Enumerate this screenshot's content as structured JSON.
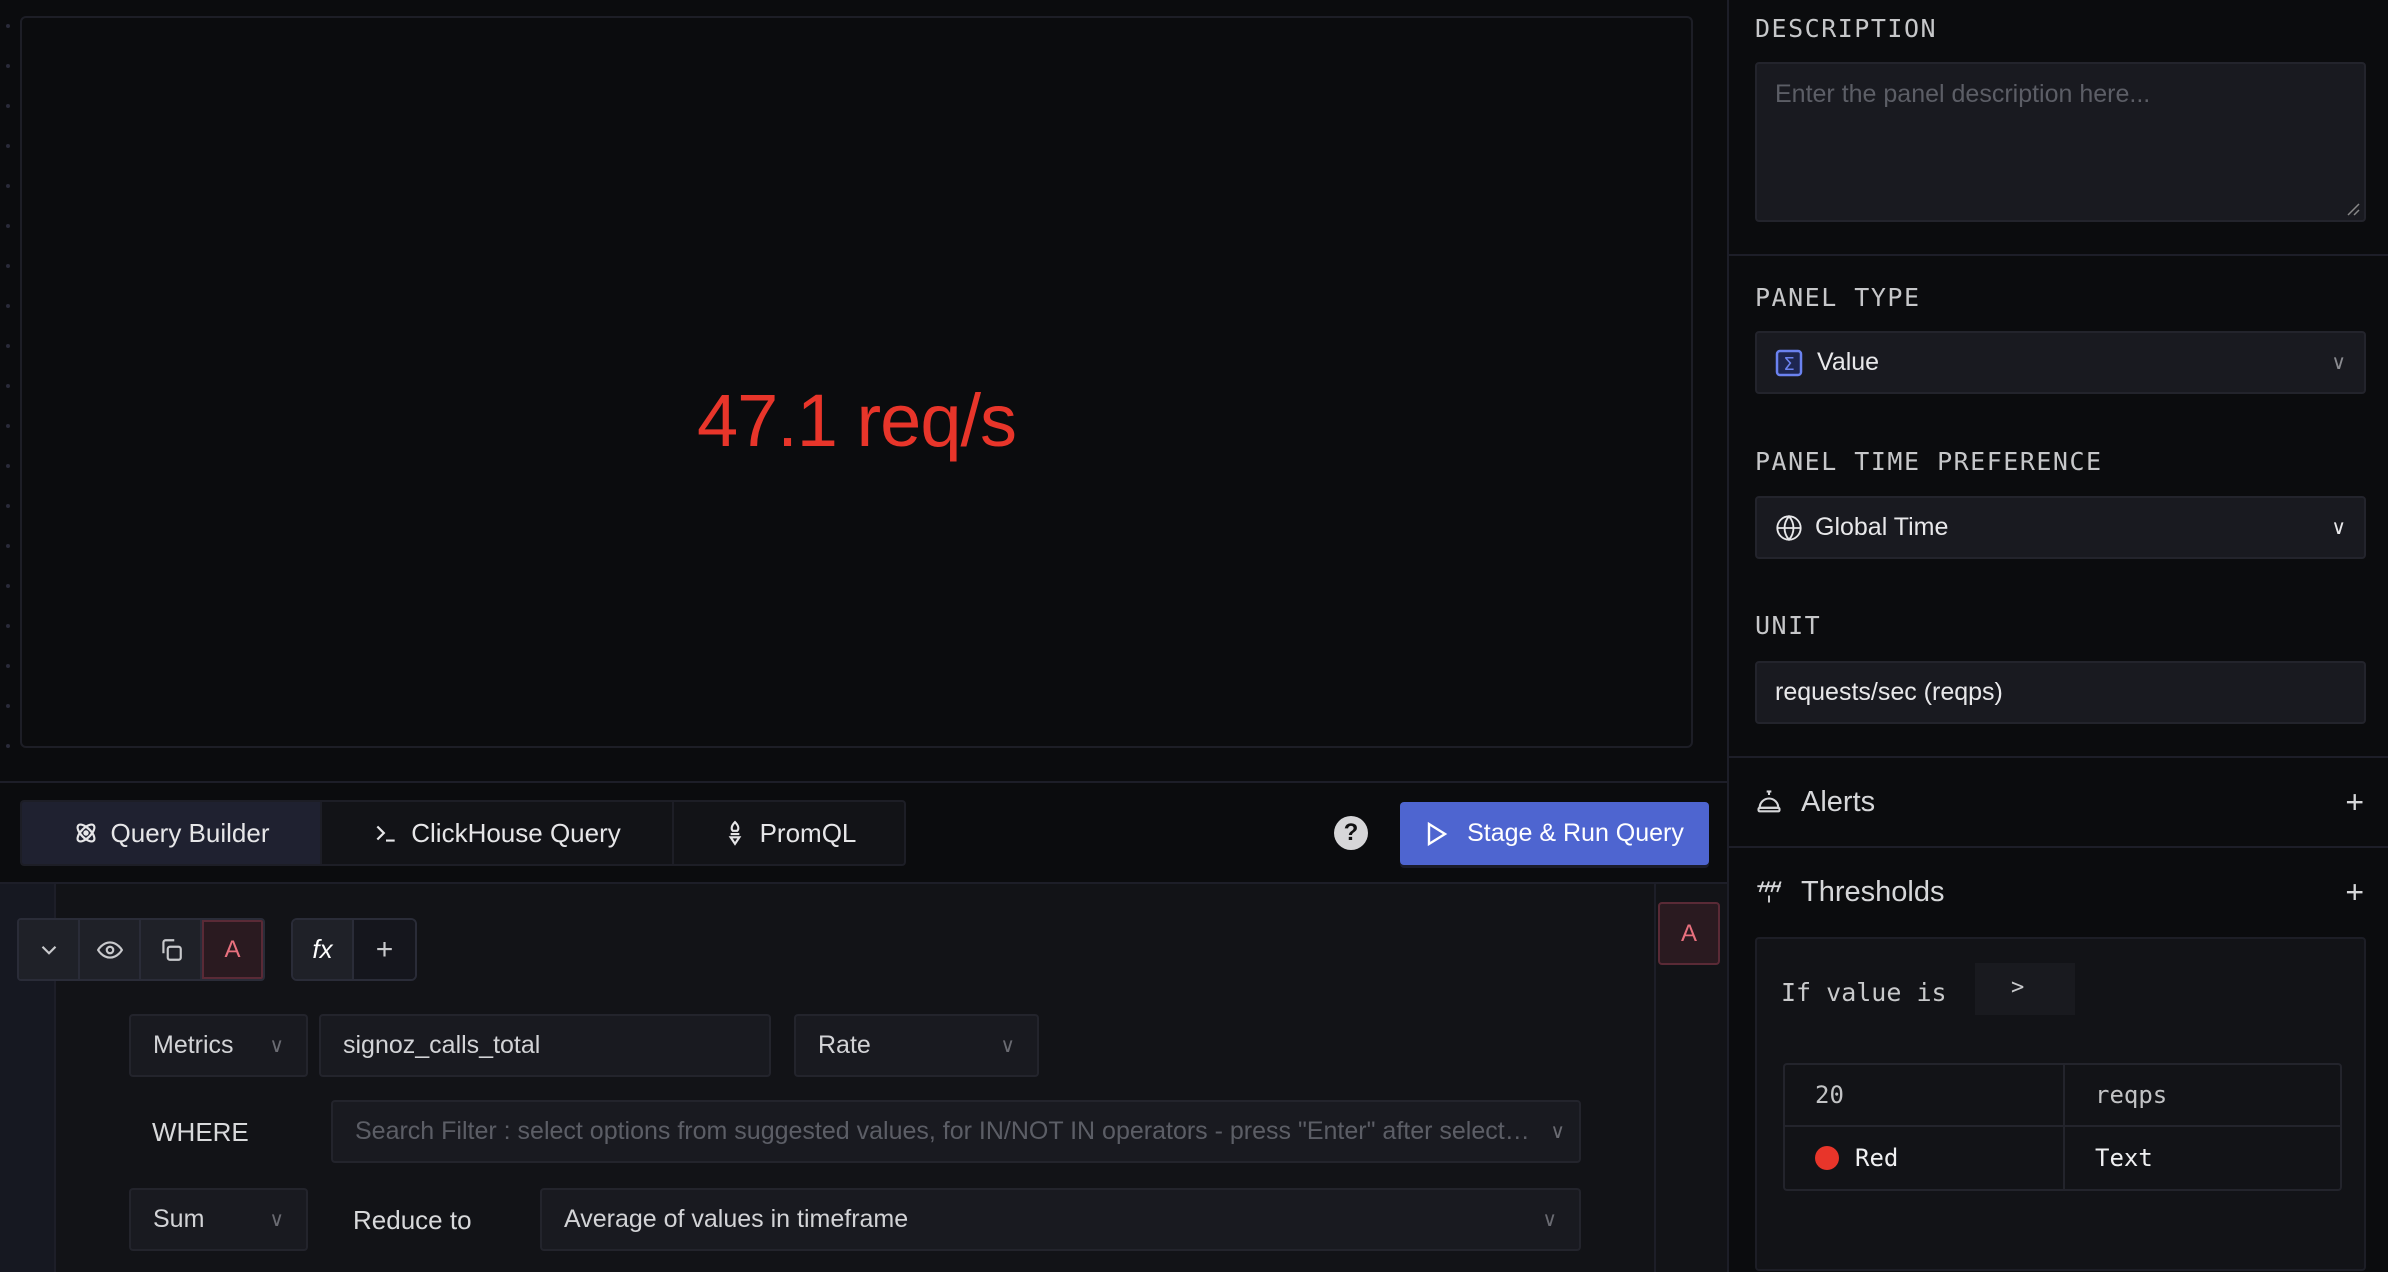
{
  "preview": {
    "value": "47.1 req/s",
    "value_color": "#e8352a"
  },
  "query_tabs": [
    {
      "label": "Query Builder",
      "icon": "atom-icon",
      "active": true
    },
    {
      "label": "ClickHouse Query",
      "icon": "terminal-icon",
      "active": false
    },
    {
      "label": "PromQL",
      "icon": "promql-torch-icon",
      "active": false
    }
  ],
  "toolbar": {
    "help_label": "?",
    "stage_run_label": "Stage & Run Query",
    "accent": "#4e65d0"
  },
  "query": {
    "name": "A",
    "function_label": "fx",
    "add_label": "+",
    "data_source": "Metrics",
    "metric_name": "signoz_calls_total",
    "aggregate_operator": "Rate",
    "where_label": "WHERE",
    "filter_placeholder": "Search Filter : select options from suggested values, for IN/NOT IN operators - press \"Enter\" after selecting options",
    "space_aggregation": "Sum",
    "reduce_to_label": "Reduce to",
    "reduce_to_value": "Average of values in timeframe"
  },
  "settings": {
    "description_title": "DESCRIPTION",
    "description_placeholder": "Enter the panel description here...",
    "panel_type_title": "PANEL TYPE",
    "panel_type_value": "Value",
    "time_pref_title": "PANEL TIME PREFERENCE",
    "time_pref_value": "Global Time",
    "unit_title": "UNIT",
    "unit_value": "requests/sec (reqps)",
    "alerts_label": "Alerts",
    "thresholds_label": "Thresholds"
  },
  "threshold": {
    "condition_label": "If value is",
    "operator": ">",
    "value": "20",
    "unit": "reqps",
    "color_name": "Red",
    "color_hex": "#e8352a",
    "format": "Text"
  }
}
